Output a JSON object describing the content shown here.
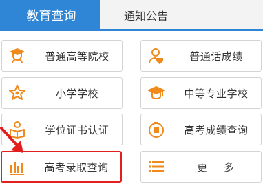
{
  "tabs": {
    "active_label": "教育查询",
    "inactive_label": "通知公告"
  },
  "colors": {
    "accent_blue": "#2f86d6",
    "icon_orange": "#f08a1c",
    "highlight_red": "#e31e1e"
  },
  "cards": [
    {
      "label": "普通高等院校",
      "icon": "graduate-person-icon"
    },
    {
      "label": "普通话成绩",
      "icon": "person-badge-icon"
    },
    {
      "label": "小学学校",
      "icon": "star-badge-icon"
    },
    {
      "label": "中等专业学校",
      "icon": "mortarboard-icon"
    },
    {
      "label": "学位证书认证",
      "icon": "reading-person-icon"
    },
    {
      "label": "高考成绩查询",
      "icon": "exam-results-icon"
    },
    {
      "label": "高考录取查询",
      "icon": "bar-chart-icon"
    },
    {
      "label": "更多",
      "icon": "list-icon"
    }
  ]
}
